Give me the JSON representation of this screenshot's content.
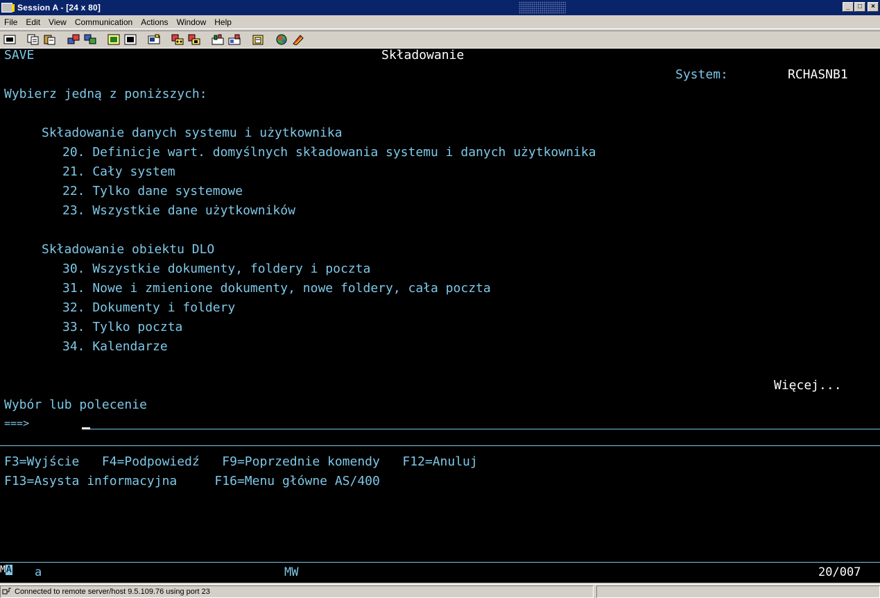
{
  "window": {
    "title": "Session A - [24 x 80]",
    "minimize_label": "_",
    "maximize_label": "□",
    "close_label": "×"
  },
  "menu": {
    "items": [
      "File",
      "Edit",
      "View",
      "Communication",
      "Actions",
      "Window",
      "Help"
    ]
  },
  "toolbar": {
    "icons": [
      "print-screen-icon",
      "copy-icon",
      "paste-icon",
      "send-icon",
      "receive-icon",
      "display-icon",
      "macro-icon",
      "record-icon",
      "play-macro-icon",
      "stop-macro-icon",
      "keyboard-icon",
      "clipboard-icon",
      "color-icon",
      "map-icon"
    ]
  },
  "screen": {
    "panel_id": "SAVE",
    "panel_title": "Składowanie",
    "system_label": "System:",
    "system_name": "RCHASNB1",
    "instruction": "Wybierz jedną z poniższych:",
    "group1_title": "Składowanie danych systemu i użytkownika",
    "group1_options": [
      "20. Definicje wart. domyślnych składowania systemu i danych użytkownika",
      "21. Cały system",
      "22. Tylko dane systemowe",
      "23. Wszystkie dane użytkowników"
    ],
    "group2_title": "Składowanie obiektu DLO",
    "group2_options": [
      "30. Wszystkie dokumenty, foldery i poczta",
      "31. Nowe i zmienione dokumenty, nowe foldery, cała poczta",
      "32. Dokumenty i foldery",
      "33. Tylko poczta",
      "34. Kalendarze"
    ],
    "more": "Więcej...",
    "command_label": "Wybór lub polecenie",
    "command_prompt": "===>",
    "command_value": "",
    "fkeys_line1": "F3=Wyjście   F4=Podpowiedź   F9=Poprzednie komendy   F12=Anuluj",
    "fkeys_line2": "F13=Asysta informacyjna     F16=Menu główne AS/400"
  },
  "oia": {
    "ma": "MA",
    "session": "a",
    "mw": "MW",
    "position": "20/007"
  },
  "status": {
    "text": "Connected to remote server/host 9.5.109.76 using port 23"
  },
  "colors": {
    "terminal_bg": "#000000",
    "terminal_text": "#7ec8e8",
    "terminal_highlight": "#ffffff",
    "titlebar": "#0a246a"
  }
}
